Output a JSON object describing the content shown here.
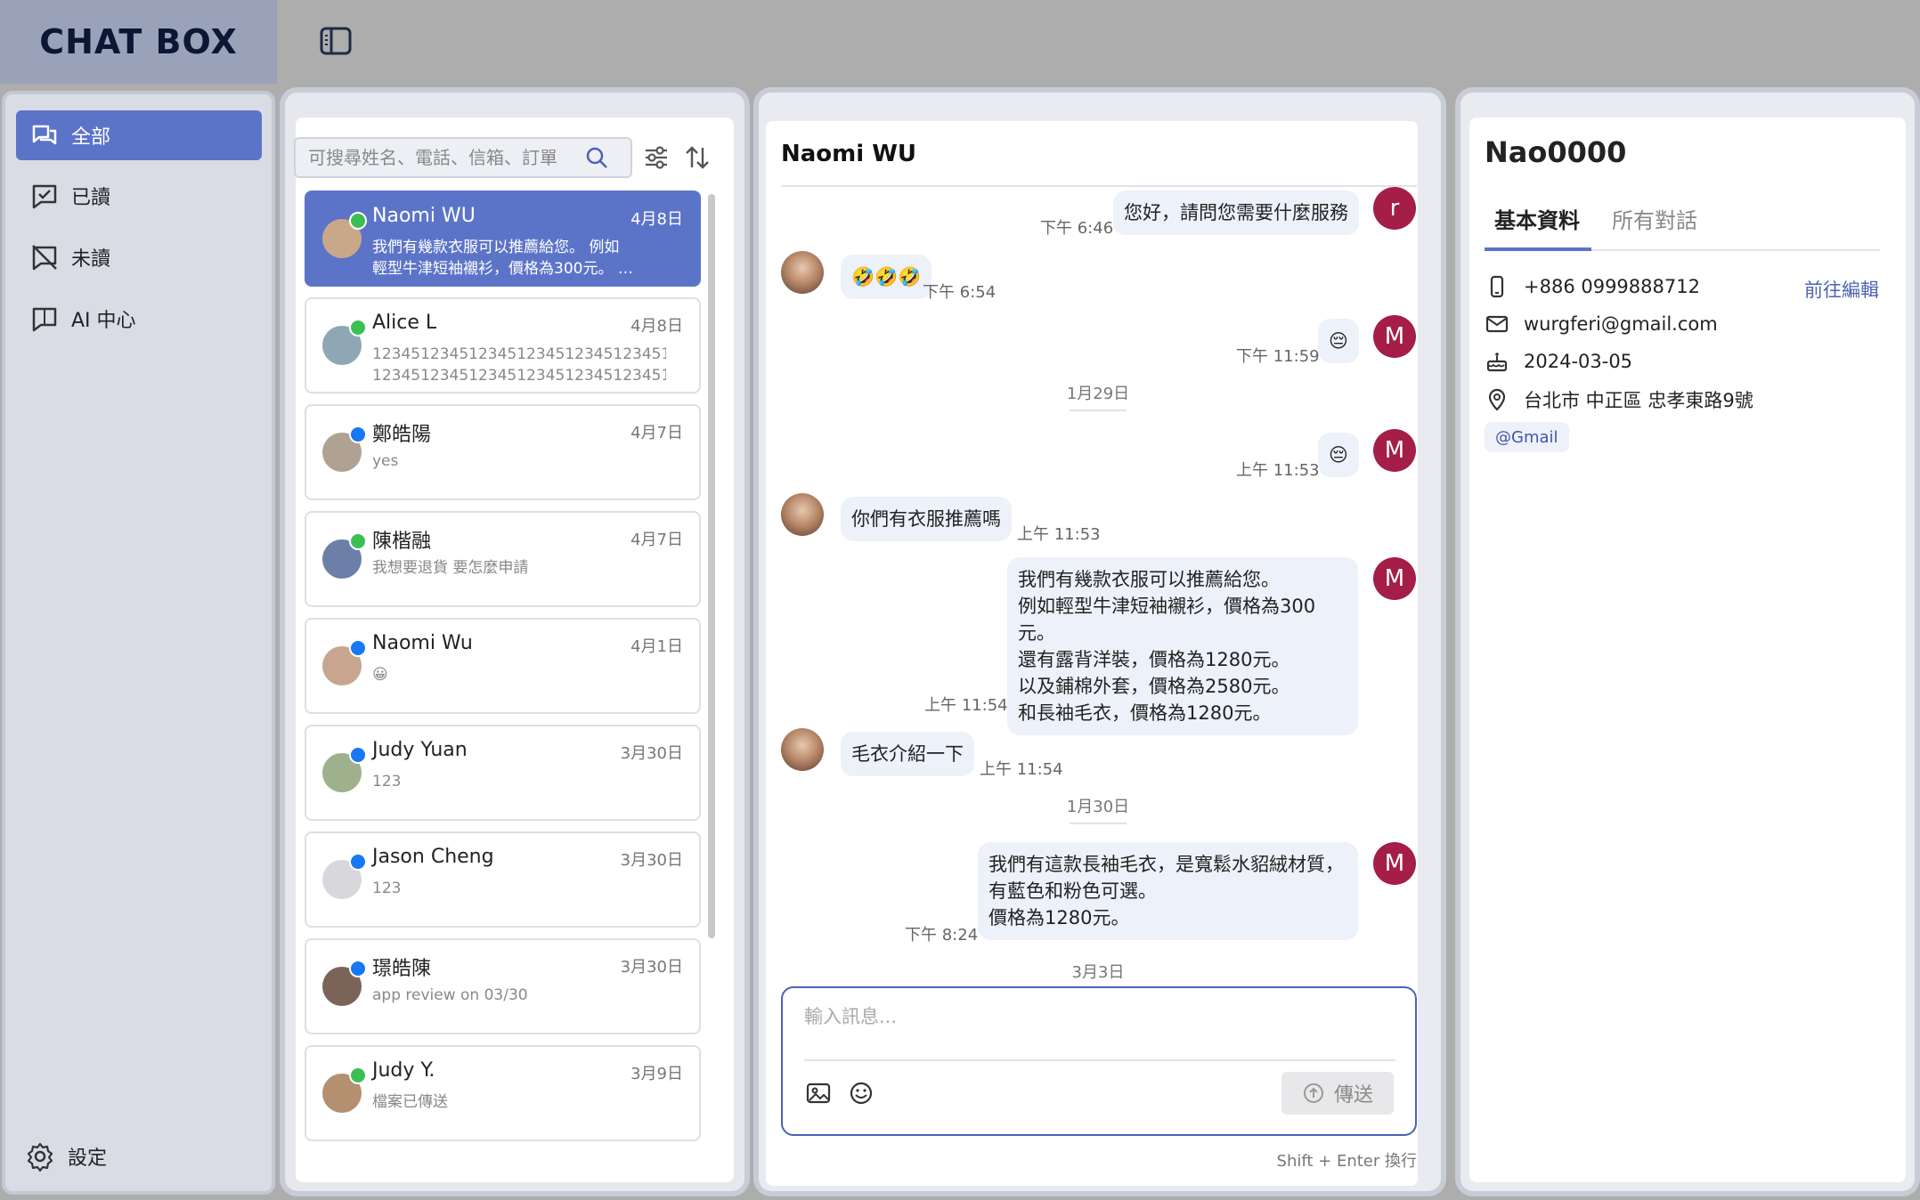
{
  "app": {
    "logo": "CHAT BOX"
  },
  "nav": {
    "items": [
      {
        "label": "全部"
      },
      {
        "label": "已讀"
      },
      {
        "label": "未讀"
      },
      {
        "label": "AI 中心"
      }
    ],
    "settings": "設定"
  },
  "search": {
    "placeholder": "可搜尋姓名、電話、信箱、訂單"
  },
  "conversations": [
    {
      "name": "Naomi WU",
      "date": "4月8日",
      "msg": "我們有幾款衣服可以推薦給您。 例如\n輕型牛津短袖襯衫，價格為300元。 …",
      "channel": "line"
    },
    {
      "name": "Alice L",
      "date": "4月8日",
      "msg": "12345123451234512345123451234512345\n12345123451234512345123451234512345123…",
      "channel": "line"
    },
    {
      "name": "鄭皓陽",
      "date": "4月7日",
      "msg": "yes",
      "channel": "fb"
    },
    {
      "name": "陳楷融",
      "date": "4月7日",
      "msg": "我想要退貨 要怎麼申請",
      "channel": "line"
    },
    {
      "name": "Naomi Wu",
      "date": "4月1日",
      "msg": "😀",
      "channel": "fb"
    },
    {
      "name": "Judy Yuan",
      "date": "3月30日",
      "msg": "123",
      "channel": "fb"
    },
    {
      "name": "Jason Cheng",
      "date": "3月30日",
      "msg": "123",
      "channel": "fb"
    },
    {
      "name": "璟皓陳",
      "date": "3月30日",
      "msg": "app review on 03/30",
      "channel": "fb"
    },
    {
      "name": "Judy Y.",
      "date": "3月9日",
      "msg": "檔案已傳送",
      "channel": "line"
    }
  ],
  "chat": {
    "title": "Naomi WU",
    "messages": [
      {
        "text": "您好，請問您需要什麼服務",
        "time": "下午 6:46",
        "avatar": "r"
      },
      {
        "text": "🤣🤣🤣",
        "time": "下午 6:54"
      },
      {
        "text": "😔",
        "time": "下午 11:59",
        "avatar": "M"
      },
      {
        "text": "😔",
        "time": "上午 11:53",
        "avatar": "M"
      },
      {
        "text": "你們有衣服推薦嗎",
        "time": "上午 11:53"
      },
      {
        "text": "我們有幾款衣服可以推薦給您。\n例如輕型牛津短袖襯衫，價格為300元。\n還有露背洋裝，價格為1280元。\n以及鋪棉外套，價格為2580元。\n和長袖毛衣，價格為1280元。",
        "time": "上午 11:54",
        "avatar": "M"
      },
      {
        "text": "毛衣介紹一下",
        "time": "上午 11:54"
      },
      {
        "text": "我們有這款長袖毛衣，是寬鬆水貂絨材質，\n有藍色和粉色可選。\n價格為1280元。",
        "time": "下午 8:24",
        "avatar": "M"
      }
    ],
    "days": [
      "1月29日",
      "1月30日",
      "3月3日"
    ],
    "input_placeholder": "輸入訊息...",
    "send_label": "傳送",
    "hint": "Shift + Enter 換行"
  },
  "profile": {
    "name": "Nao0000",
    "tabs": [
      "基本資料",
      "所有對話"
    ],
    "phone": "+886 0999888712",
    "edit_label": "前往編輯",
    "email": "wurgferi@gmail.com",
    "birthday": "2024-03-05",
    "address": "台北市 中正區 忠孝東路9號",
    "tag": "@Gmail"
  }
}
